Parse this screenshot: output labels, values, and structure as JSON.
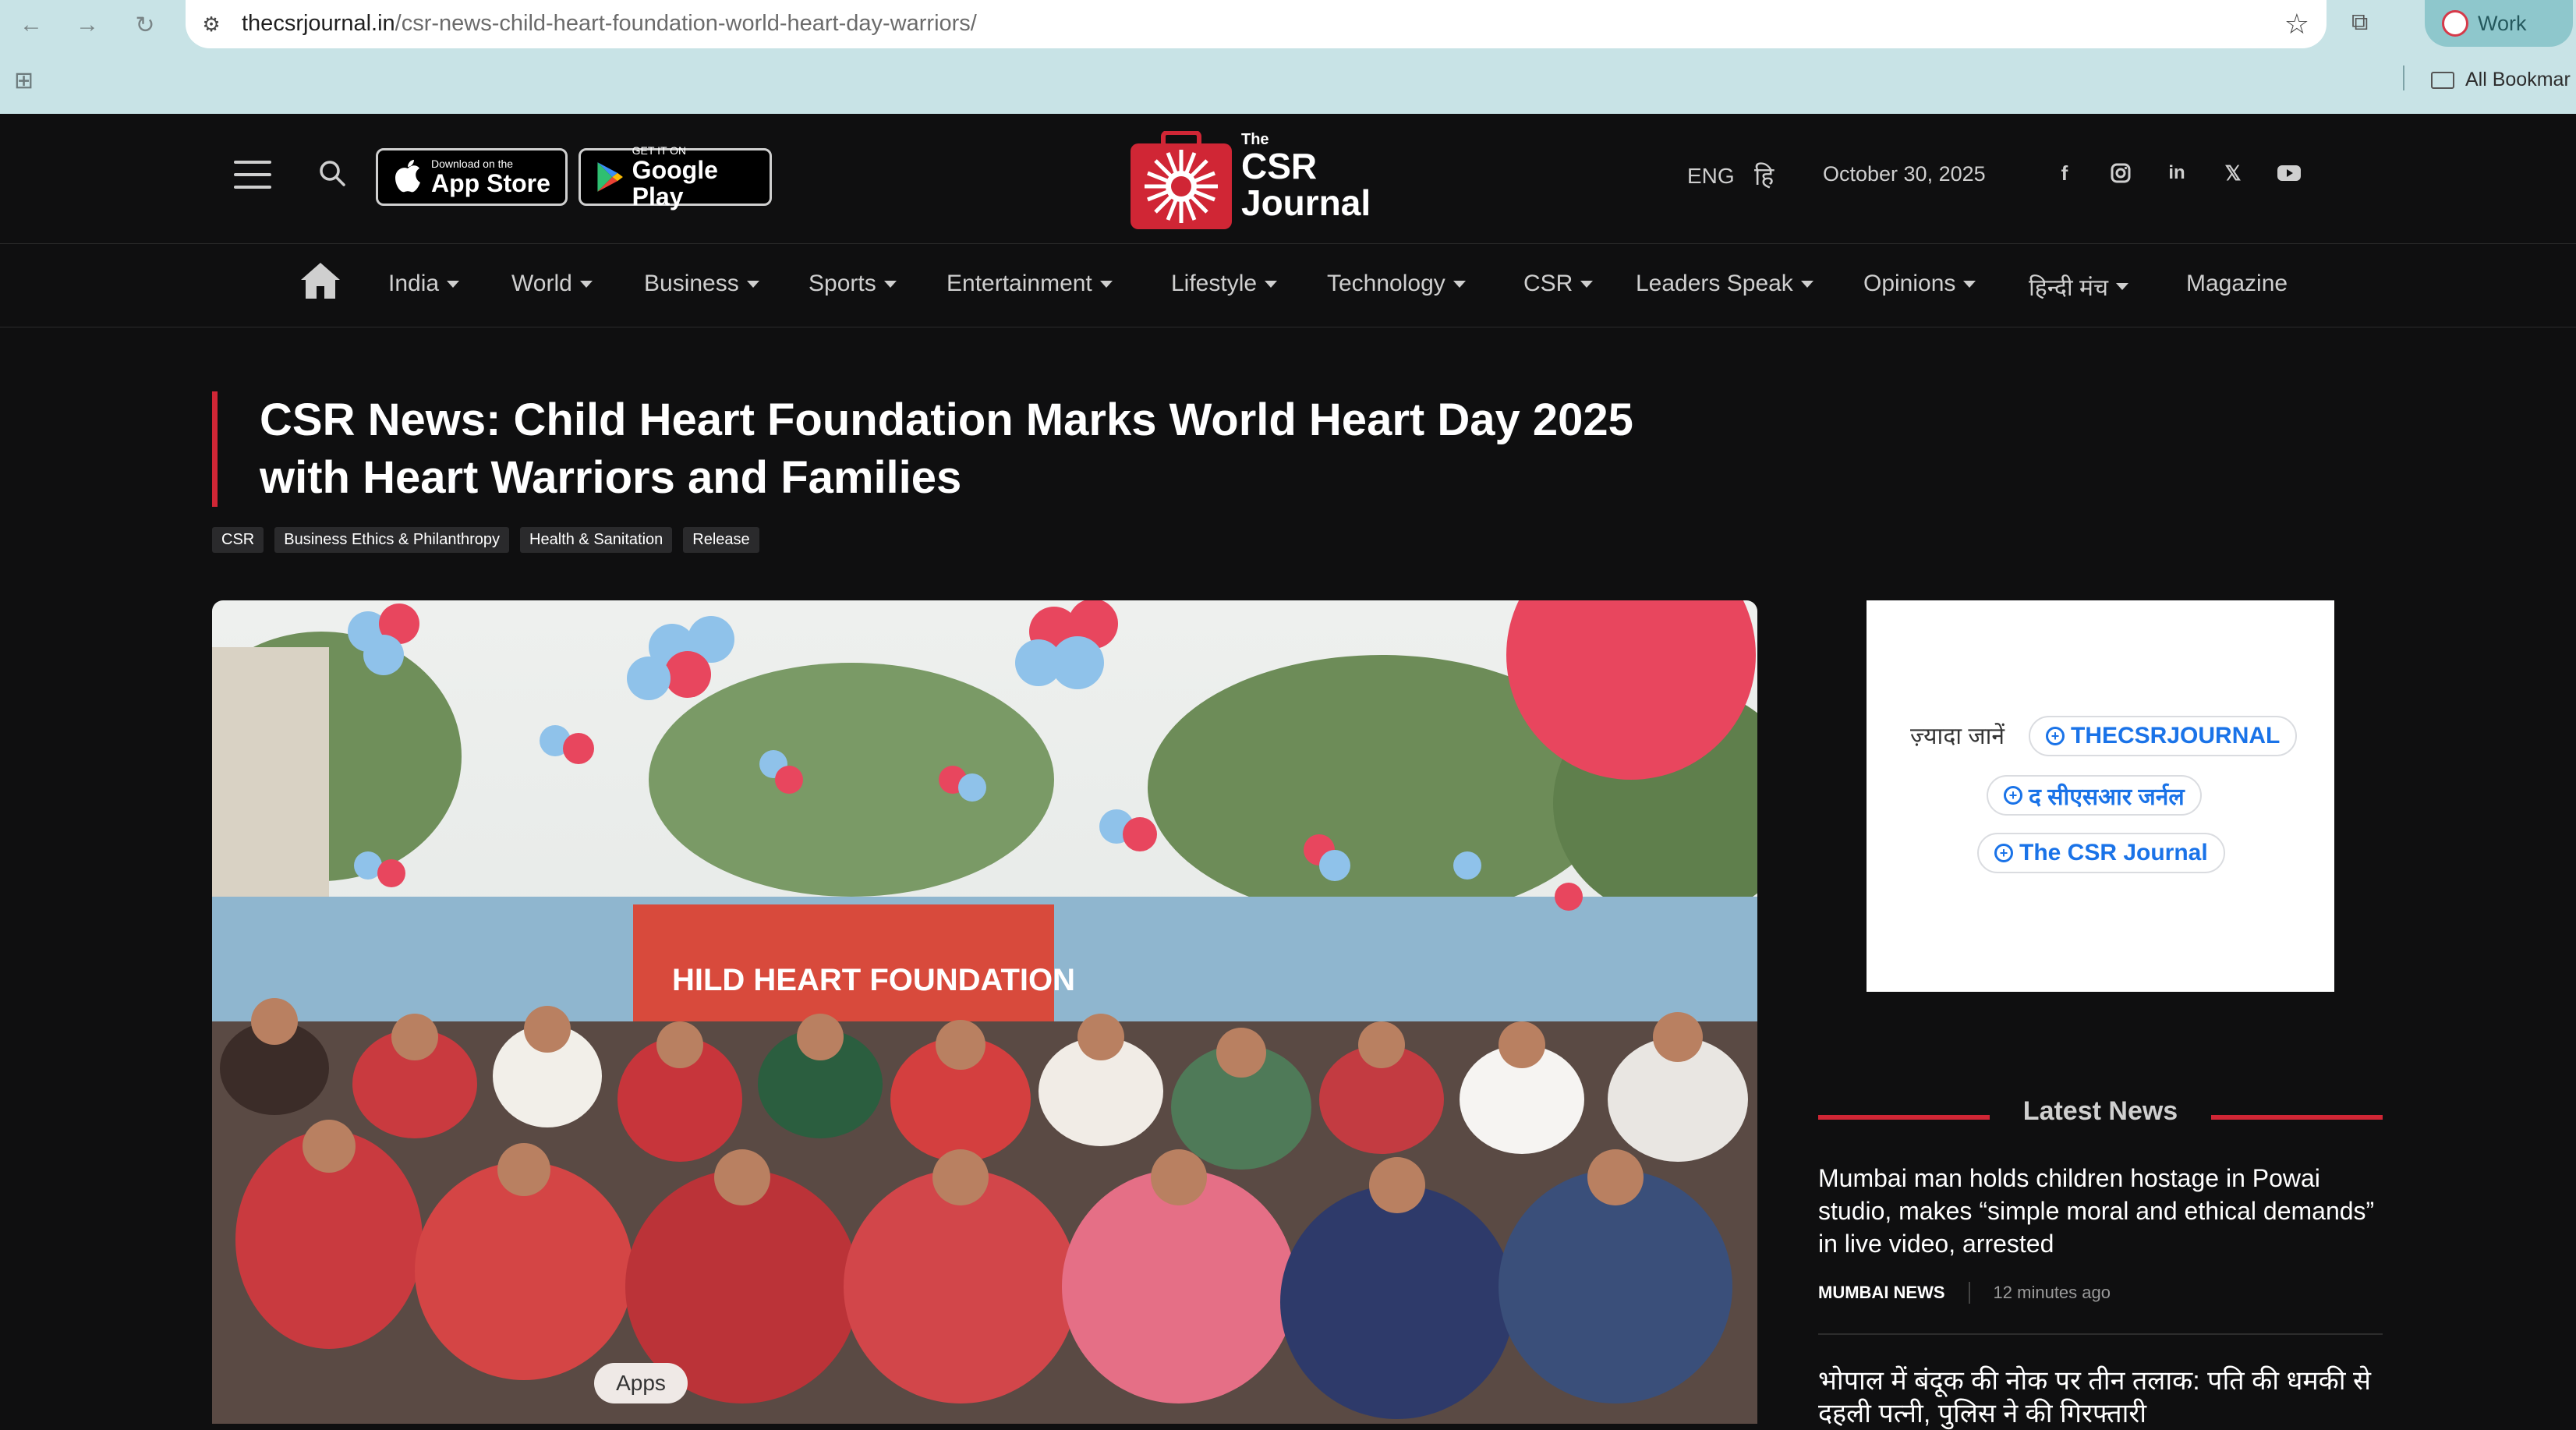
{
  "browser": {
    "url_host": "thecsrjournal.in",
    "url_path": "/csr-news-child-heart-foundation-world-heart-day-warriors/",
    "profile_label": "Work",
    "all_bookmarks_label": "All Bookmar"
  },
  "header": {
    "app_store": {
      "small": "Download on the",
      "large": "App Store"
    },
    "google_play": {
      "small": "GET IT ON",
      "large": "Google Play"
    },
    "logo": {
      "the": "The",
      "csr": "CSR",
      "journal": "Journal"
    },
    "language": "ENG",
    "hindi_toggle": "हि",
    "date": "October 30, 2025",
    "social_icons": [
      "facebook-icon",
      "instagram-icon",
      "linkedin-icon",
      "x-icon",
      "youtube-icon"
    ]
  },
  "menu": {
    "items": [
      {
        "label": "India",
        "dropdown": true
      },
      {
        "label": "World",
        "dropdown": true
      },
      {
        "label": "Business",
        "dropdown": true
      },
      {
        "label": "Sports",
        "dropdown": true
      },
      {
        "label": "Entertainment",
        "dropdown": true
      },
      {
        "label": "Lifestyle",
        "dropdown": true
      },
      {
        "label": "Technology",
        "dropdown": true
      },
      {
        "label": "CSR",
        "dropdown": true
      },
      {
        "label": "Leaders Speak",
        "dropdown": true
      },
      {
        "label": "Opinions",
        "dropdown": true
      },
      {
        "label": "हिन्दी मंच",
        "dropdown": true
      },
      {
        "label": "Magazine",
        "dropdown": false
      }
    ]
  },
  "article": {
    "title_line1": "CSR News: Child Heart Foundation Marks World Heart Day 2025",
    "title_line2": "with Heart Warriors and Families",
    "tags": [
      "CSR",
      "Business Ethics & Philanthropy",
      "Health & Sanitation",
      "Release"
    ],
    "hero_banner_text": "HILD HEART FOUNDATION",
    "apps_chip": "Apps"
  },
  "sidebar": {
    "ad": {
      "lead": "ज़्यादा जानें",
      "pills": [
        "THECSRJOURNAL",
        "द सीएसआर जर्नल",
        "The CSR Journal"
      ]
    },
    "latest_news": {
      "heading": "Latest News",
      "items": [
        {
          "title": "Mumbai man holds children hostage in Powai studio, makes “simple moral and ethical demands” in live video, arrested",
          "category": "MUMBAI NEWS",
          "time": "12 minutes ago"
        },
        {
          "title": "भोपाल में बंदूक की नोक पर तीन तलाक: पति की धमकी से दहली पत्नी, पुलिस ने की गिरफ्तारी"
        }
      ]
    }
  },
  "colors": {
    "accent": "#d02635",
    "page_bg": "#0f0f10",
    "chrome_bg": "#c8e3e6",
    "link_blue": "#1a73e8"
  }
}
